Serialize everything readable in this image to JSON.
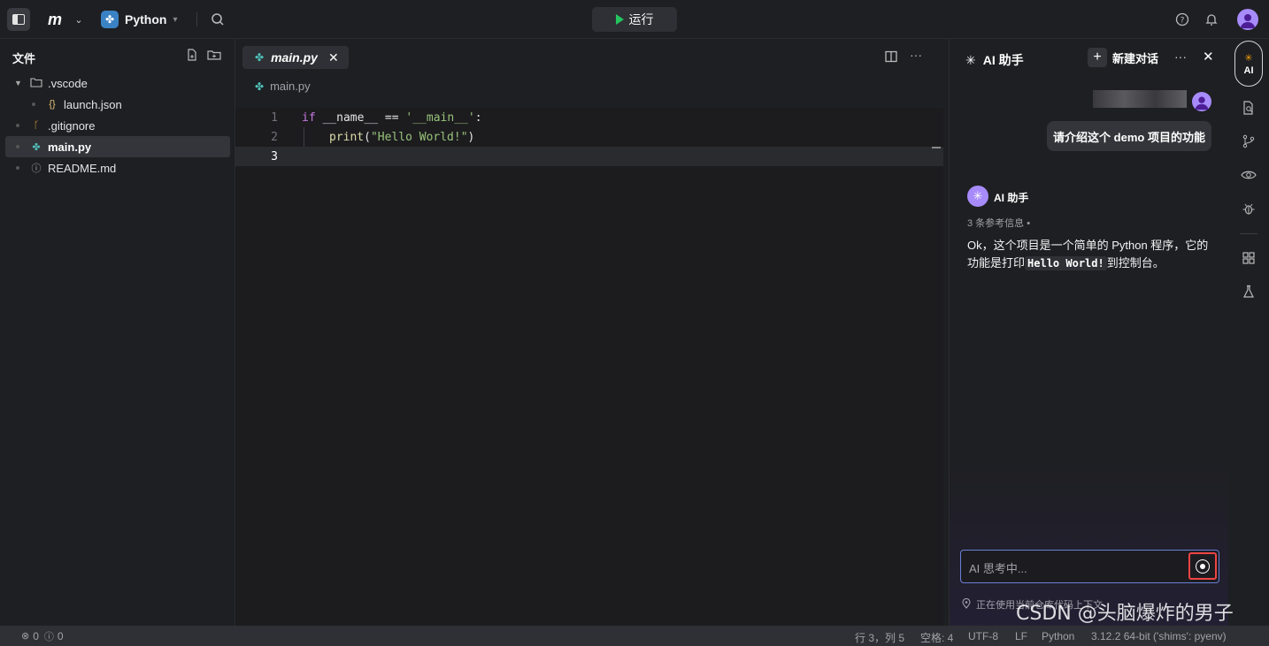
{
  "topbar": {
    "project_name": "Python",
    "run_label": "运行"
  },
  "explorer": {
    "title": "文件",
    "items": [
      {
        "label": ".vscode",
        "type": "folder"
      },
      {
        "label": "launch.json",
        "type": "json"
      },
      {
        "label": ".gitignore",
        "type": "git"
      },
      {
        "label": "main.py",
        "type": "python"
      },
      {
        "label": "README.md",
        "type": "info"
      }
    ]
  },
  "editor": {
    "tab_label": "main.py",
    "breadcrumb": "main.py",
    "line_numbers": [
      "1",
      "2",
      "3"
    ],
    "lines": {
      "l1_kw": "if",
      "l1_rest": " __name__ == ",
      "l1_str": "'__main__'",
      "l1_end": ":",
      "l2_fn": "print",
      "l2_open": "(",
      "l2_str": "\"Hello World!\"",
      "l2_close": ")"
    }
  },
  "ai": {
    "title": "AI 助手",
    "new_chat": "新建对话",
    "user_message": "请介绍这个 demo 项目的功能",
    "bot_name": "AI 助手",
    "refs": "3 条参考信息  •",
    "answer_part1": "Ok，这个项目是一个简单的 Python 程序，它的功能是打印",
    "answer_code": "Hello World!",
    "answer_part2": "到控制台。",
    "input_placeholder": "AI 思考中...",
    "context_note": "正在使用当前仓库代码上下文"
  },
  "activity": {
    "ai_label": "AI"
  },
  "status": {
    "errors": "0",
    "warnings": "0",
    "position": "行 3，列 5",
    "spaces": "空格: 4",
    "encoding": "UTF-8",
    "eol": "LF",
    "language": "Python",
    "interpreter": "3.12.2 64-bit ('shims': pyenv)"
  },
  "watermark": "CSDN @头脑爆炸的男子"
}
